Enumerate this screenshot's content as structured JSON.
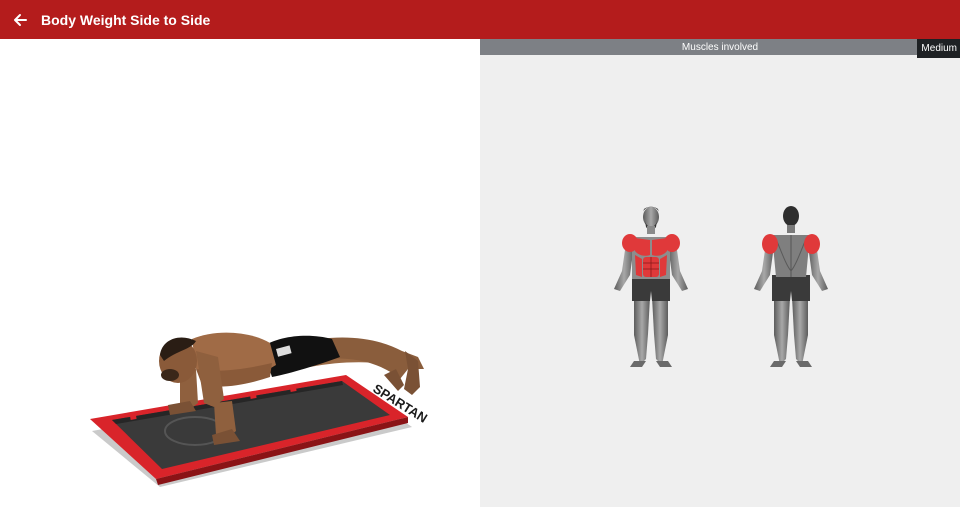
{
  "appbar": {
    "title": "Body Weight Side to Side",
    "back_icon": "arrow-left-icon",
    "color": "#b41c1c"
  },
  "exercise_illustration": {
    "mat_text": "SPARTAN"
  },
  "muscles_panel": {
    "header": "Muscles involved",
    "difficulty": "Medium",
    "highlight_color": "#e0393a",
    "front_view": {
      "highlighted": [
        "shoulders",
        "chest",
        "abs"
      ]
    },
    "back_view": {
      "highlighted": [
        "shoulders"
      ]
    }
  }
}
